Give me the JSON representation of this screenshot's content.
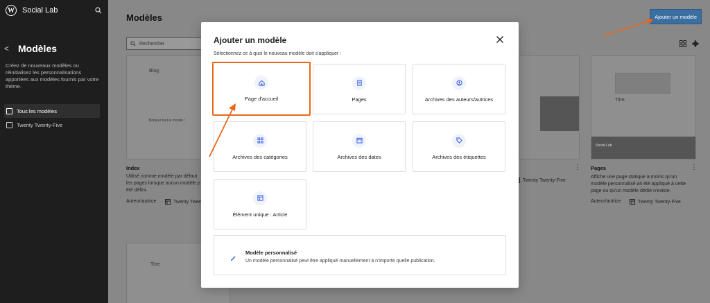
{
  "sidebar": {
    "site_name": "Social Lab",
    "back": "<",
    "title": "Modèles",
    "description": "Créez de nouveaux modèles ou réinitialisez les personnalisations apportées aux modèles fournis par votre thème.",
    "items": [
      {
        "label": "Tous les modèles",
        "active": true
      },
      {
        "label": "Twenty Twenty-Five",
        "active": false
      }
    ]
  },
  "main": {
    "title": "Modèles",
    "add_button": "Ajouter un modèle",
    "search_placeholder": "Rechercher",
    "cards": [
      {
        "title": "Index",
        "desc_1": "Utilisé comme modèle par défaut",
        "desc_2": "les pages lorsque aucun modèle p",
        "desc_3": "été défini.",
        "author": "Auteur/autrice",
        "theme": "Twenty Twenty"
      },
      {
        "theme": "Twenty Twenty-Five"
      },
      {
        "title": "Pages",
        "desc_1": "Affiche une page statique à moins qu'un",
        "desc_2": "modèle personnalisé ait été appliqué à cette",
        "desc_3": "page ou qu'un modèle dédié n'existe.",
        "author": "Auteur/autrice",
        "theme": "Twenty Twenty-Five"
      }
    ],
    "thumb_texts": {
      "blog": "Blog",
      "hello": "Bonjour tout le monde !",
      "titre": "Titre",
      "titre2": "Titre",
      "social": "Social Lab"
    }
  },
  "modal": {
    "title": "Ajouter un modèle",
    "subtitle": "Sélectionnez ce à quoi le nouveau modèle doit s'appliquer :",
    "options": [
      {
        "label": "Page d'accueil",
        "icon": "home-icon"
      },
      {
        "label": "Pages",
        "icon": "page-icon"
      },
      {
        "label": "Archives des auteurs/autrices",
        "icon": "user-icon"
      },
      {
        "label": "Archives des catégories",
        "icon": "category-icon"
      },
      {
        "label": "Archives des dates",
        "icon": "calendar-icon"
      },
      {
        "label": "Archives des étiquettes",
        "icon": "tag-icon"
      },
      {
        "label": "Élément unique : Article",
        "icon": "post-icon"
      }
    ],
    "custom": {
      "title": "Modèle personnalisé",
      "description": "Un modèle personnalisé peut être appliqué manuellement à n'importe quelle publication."
    }
  },
  "colors": {
    "accent": "#3858e9",
    "highlight": "#e8671b",
    "button": "#3b6fa0"
  }
}
